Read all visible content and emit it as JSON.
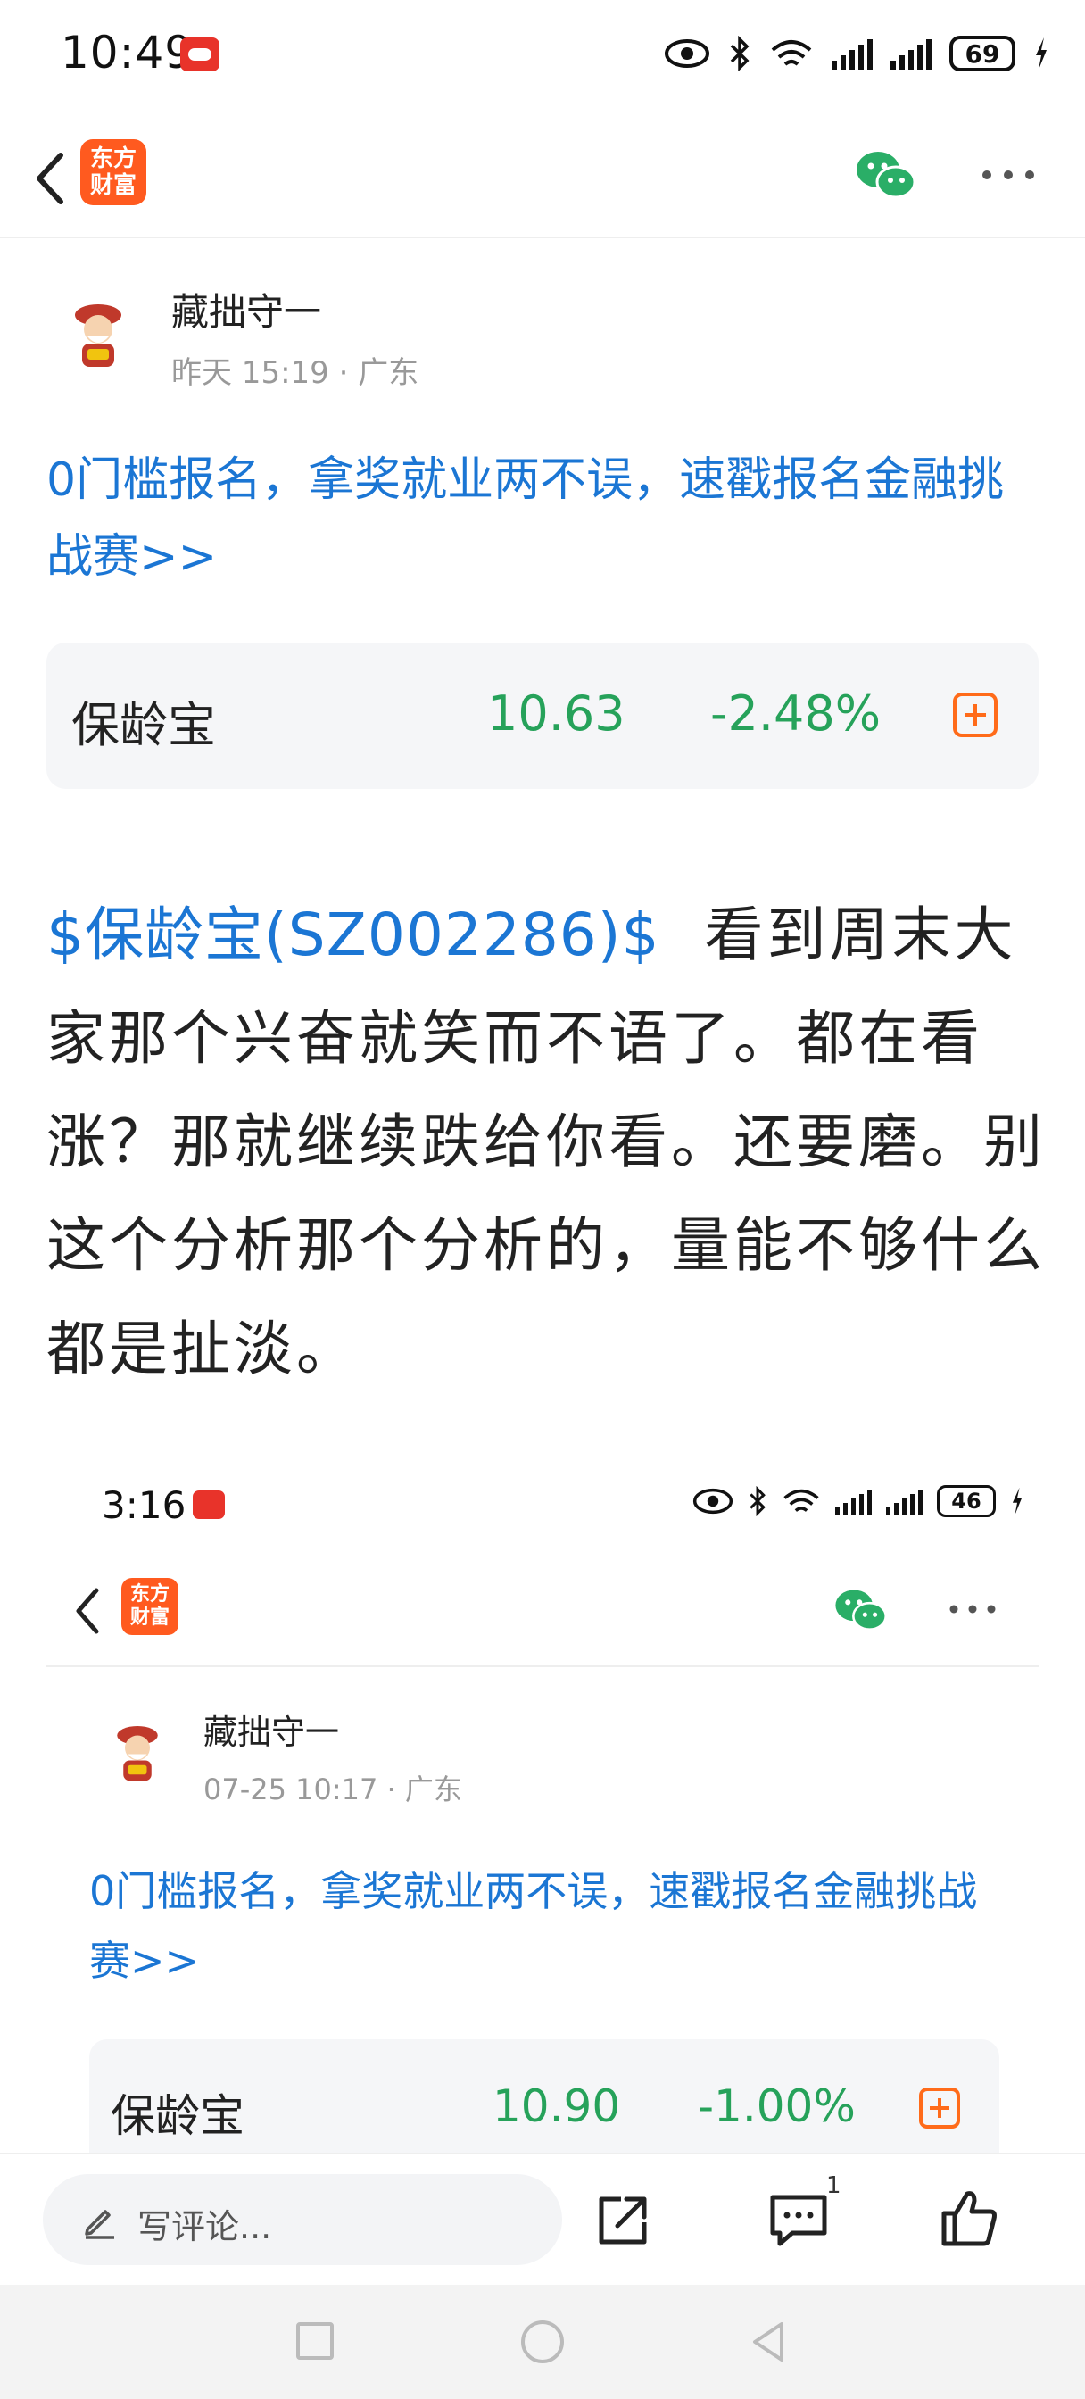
{
  "status_bar": {
    "time": "10:49",
    "battery": "69"
  },
  "nav": {
    "logo_line1": "东方",
    "logo_line2": "财富"
  },
  "post": {
    "author": "藏拙守一",
    "meta": "昨天 15:19 · 广东",
    "promo": "0门槛报名，拿奖就业两不误，速戳报名金融挑战赛>>",
    "stock": {
      "name": "保龄宝",
      "price": "10.63",
      "change": "-2.48%"
    },
    "tag": "$保龄宝(SZ002286)$",
    "body": "看到周末大家那个兴奋就笑而不语了。都在看涨？那就继续跌给你看。还要磨。别这个分析那个分析的，量能不够什么都是扯淡。"
  },
  "embedded_screenshot": {
    "time": "3:16",
    "battery": "46",
    "logo_line1": "东方",
    "logo_line2": "财富",
    "author": "藏拙守一",
    "meta": "07-25 10:17 · 广东",
    "promo": "0门槛报名，拿奖就业两不误，速戳报名金融挑战赛>>",
    "stock": {
      "name": "保龄宝",
      "price": "10.90",
      "change": "-1.00%"
    }
  },
  "bottom_bar": {
    "comment_placeholder": "写评论...",
    "comment_count": "1"
  },
  "colors": {
    "link_blue": "#1b76d4",
    "stock_down_green": "#26a25a",
    "brand_orange": "#ff5a1f"
  }
}
